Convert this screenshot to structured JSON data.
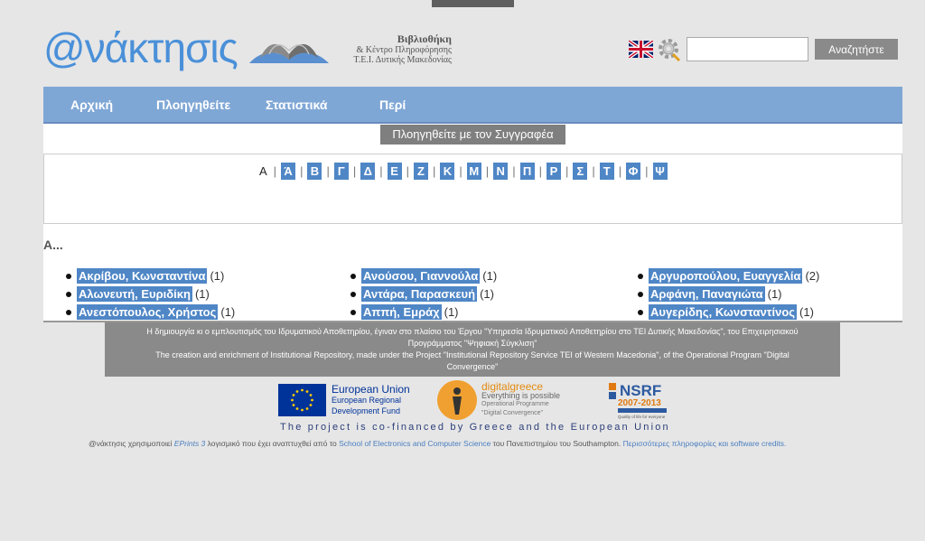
{
  "header": {
    "logo_text": "@νάκτησις",
    "library_line1": "Βιβλιοθήκη",
    "library_line2": "& Κέντρο Πληροφόρησης",
    "library_line3": "Τ.Ε.Ι. Δυτικής Μακεδονίας",
    "search_placeholder": "",
    "search_button": "Αναζητήστε"
  },
  "nav": {
    "items": [
      "Αρχική",
      "Πλοηγηθείτε",
      "Στατιστικά",
      "Περί"
    ]
  },
  "browse": {
    "badge": "Πλοηγηθείτε με τον Συγγραφέα",
    "current_letter": "Α",
    "letters": [
      "Ά",
      "Β",
      "Γ",
      "Δ",
      "Ε",
      "Ζ",
      "Κ",
      "Μ",
      "Ν",
      "Π",
      "Ρ",
      "Σ",
      "Τ",
      "Φ",
      "Ψ"
    ],
    "section_title": "Α..."
  },
  "authors": {
    "col1": [
      {
        "name": "Ακρίβου, Κωνσταντίνα",
        "count": "(1)"
      },
      {
        "name": "Αλωνευτή, Ευριδίκη",
        "count": "(1)"
      },
      {
        "name": "Ανεστόπουλος, Χρήστος",
        "count": "(1)"
      }
    ],
    "col2": [
      {
        "name": "Ανούσου, Γιαννούλα",
        "count": "(1)"
      },
      {
        "name": "Αντάρα, Παρασκευή",
        "count": "(1)"
      },
      {
        "name": "Αππή, Εμράχ",
        "count": "(1)"
      }
    ],
    "col3": [
      {
        "name": "Αργυροπούλου, Ευαγγελία",
        "count": "(2)"
      },
      {
        "name": "Αρφάνη, Παναγιώτα",
        "count": "(1)"
      },
      {
        "name": "Αυγερίδης, Κωνσταντίνος",
        "count": "(1)"
      }
    ]
  },
  "footer": {
    "greek_line1": "Η δημιουργία κι ο εμπλουτισμός του Ιδρυματικού Αποθετηρίου, έγιναν στο πλαίσιο του Έργου \"Υπηρεσία Ιδρυματικού Αποθετηρίου στο ΤΕΙ Δυτικής Μακεδονίας\", του Επιχειρησιακού",
    "greek_line2": "Προγράμματος \"Ψηφιακή Σύγκλιση\"",
    "english_line1": "The creation and enrichment of Institutional Repository, made under the Project \"Institutional Repository Service TEI of Western Macedonia\", of the Operational Program \"Digital",
    "english_line2": "Convergence\"",
    "eu_title": "European Union",
    "eu_sub1": "European Regional",
    "eu_sub2": "Development Fund",
    "dg_title": "digitalgreece",
    "dg_sub": "Everything is possible",
    "dg_op1": "Operational Programme",
    "dg_op2": "\"Digital Convergence\"",
    "nsrf_title": "NSRF",
    "nsrf_years": "2007-2013",
    "nsrf_sub": "Quality of life for everyone",
    "cofinanced": "The project is co-financed by Greece and the European Union",
    "credits_prefix": "@νάκτησις χρησιμοποιεί",
    "credits_eprints": "EPrints 3",
    "credits_mid": "λογισμικό που έχει αναπτυχθεί από το",
    "credits_school": "School of Electronics and Computer Science",
    "credits_univ": "του Πανεπιστημίου του Southampton.",
    "credits_more": "Περισσότερες πληροφορίες και software credits."
  },
  "colors": {
    "nav": "#7fa7d6",
    "link_bg": "#4f86c6",
    "logo": "#4a90d9",
    "footer_bg": "#8a8a8a"
  }
}
